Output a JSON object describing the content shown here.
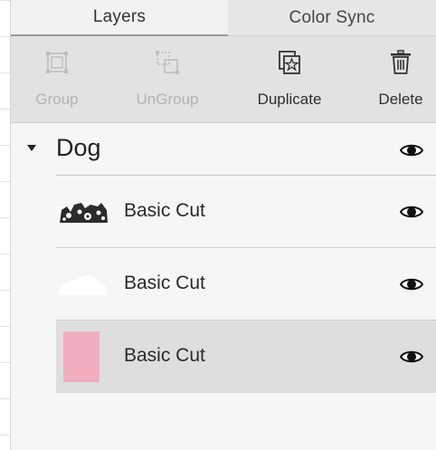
{
  "tabs": [
    {
      "label": "Layers",
      "active": true
    },
    {
      "label": "Color Sync",
      "active": false
    }
  ],
  "toolbar": {
    "group": {
      "label": "Group",
      "icon": "group-icon",
      "enabled": false
    },
    "ungroup": {
      "label": "UnGroup",
      "icon": "ungroup-icon",
      "enabled": false
    },
    "duplicate": {
      "label": "Duplicate",
      "icon": "duplicate-icon",
      "enabled": true
    },
    "delete": {
      "label": "Delete",
      "icon": "trash-icon",
      "enabled": true
    }
  },
  "layers": {
    "group": {
      "name": "Dog",
      "expanded": true,
      "visible": true
    },
    "items": [
      {
        "label": "Basic Cut",
        "thumbnail": "dog-pattern-thumbnail",
        "visible": true,
        "selected": false
      },
      {
        "label": "Basic Cut",
        "thumbnail": "white-cloud-thumbnail",
        "visible": true,
        "selected": false
      },
      {
        "label": "Basic Cut",
        "thumbnail": "pink-rectangle-thumbnail",
        "color": "#f1aebe",
        "visible": true,
        "selected": true
      }
    ]
  },
  "colors": {
    "toolbar_bg": "#e2e2e2",
    "selected_row_bg": "#dedede",
    "disabled_text": "#b3b3b3"
  }
}
